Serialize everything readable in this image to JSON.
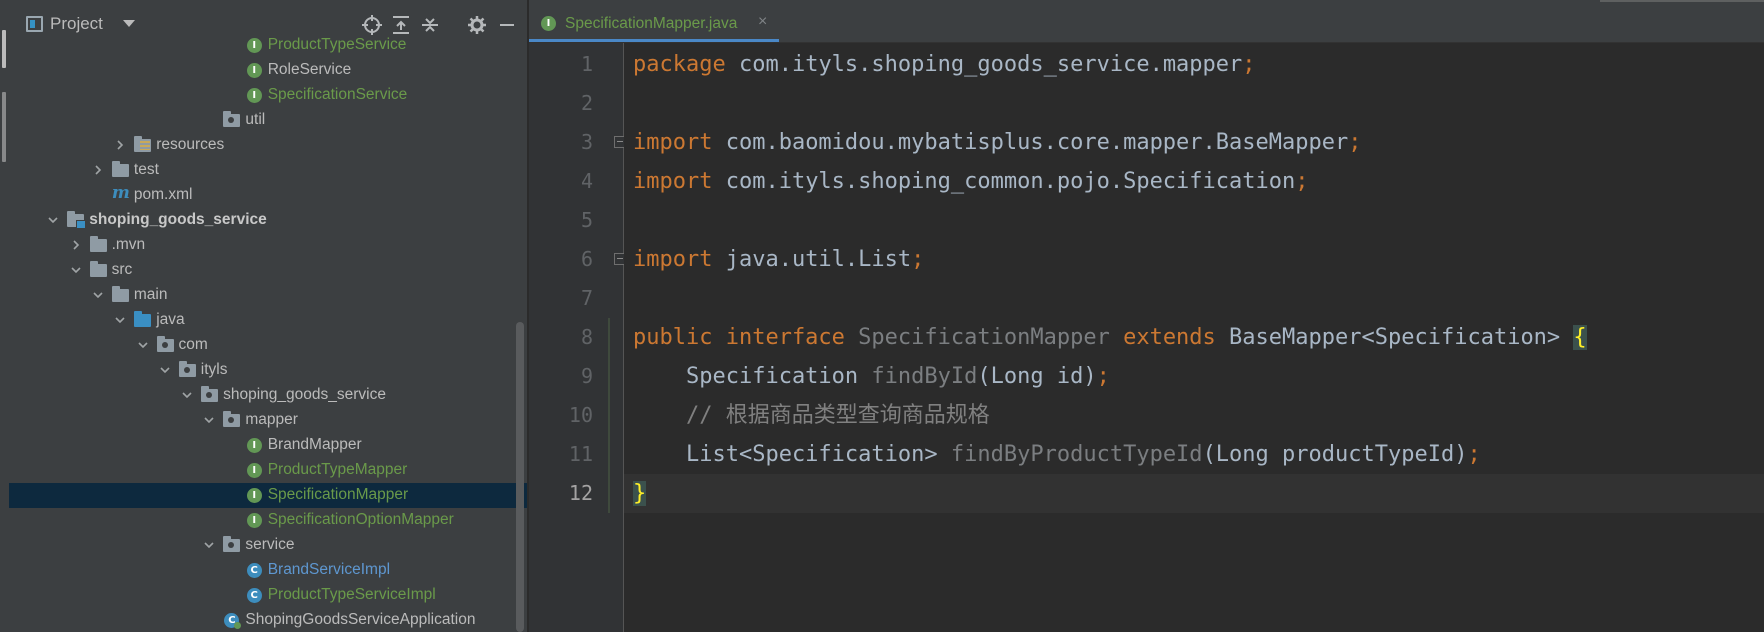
{
  "project_panel": {
    "title": "Project",
    "tree": [
      {
        "label": "ProductTypeService",
        "icon": "interface",
        "color": "green"
      },
      {
        "label": "RoleService",
        "icon": "interface",
        "color": "normal"
      },
      {
        "label": "SpecificationService",
        "icon": "interface",
        "color": "green"
      },
      {
        "label": "util",
        "icon": "package-folder",
        "color": "normal"
      },
      {
        "label": "resources",
        "icon": "resources-folder",
        "color": "normal",
        "expanded": false
      },
      {
        "label": "test",
        "icon": "folder",
        "color": "normal",
        "expanded": false
      },
      {
        "label": "pom.xml",
        "icon": "maven",
        "color": "normal"
      },
      {
        "label": "shoping_goods_service",
        "icon": "module-folder",
        "color": "bold",
        "expanded": true
      },
      {
        "label": ".mvn",
        "icon": "folder",
        "color": "normal",
        "expanded": false
      },
      {
        "label": "src",
        "icon": "folder",
        "color": "normal",
        "expanded": true
      },
      {
        "label": "main",
        "icon": "folder",
        "color": "normal",
        "expanded": true
      },
      {
        "label": "java",
        "icon": "source-folder",
        "color": "normal",
        "expanded": true
      },
      {
        "label": "com",
        "icon": "package-folder",
        "color": "normal",
        "expanded": true
      },
      {
        "label": "ityls",
        "icon": "package-folder",
        "color": "normal",
        "expanded": true
      },
      {
        "label": "shoping_goods_service",
        "icon": "package-folder",
        "color": "normal",
        "expanded": true
      },
      {
        "label": "mapper",
        "icon": "package-folder",
        "color": "normal",
        "expanded": true
      },
      {
        "label": "BrandMapper",
        "icon": "interface",
        "color": "normal"
      },
      {
        "label": "ProductTypeMapper",
        "icon": "interface",
        "color": "green"
      },
      {
        "label": "SpecificationMapper",
        "icon": "interface",
        "color": "green",
        "selected": true
      },
      {
        "label": "SpecificationOptionMapper",
        "icon": "interface",
        "color": "green"
      },
      {
        "label": "service",
        "icon": "package-folder",
        "color": "normal",
        "expanded": true
      },
      {
        "label": "BrandServiceImpl",
        "icon": "class",
        "color": "blue"
      },
      {
        "label": "ProductTypeServiceImpl",
        "icon": "class",
        "color": "green"
      },
      {
        "label": "ShopingGoodsServiceApplication",
        "icon": "spring-app",
        "color": "normal"
      }
    ]
  },
  "editor": {
    "tab": {
      "title": "SpecificationMapper.java",
      "close": "×",
      "icon": "interface"
    },
    "current_line": 12,
    "lines": [
      {
        "n": "1",
        "tokens": [
          {
            "t": "package ",
            "c": "kw"
          },
          {
            "t": "com.ityls.shoping_goods_service.mapper",
            "c": ""
          },
          {
            "t": ";",
            "c": "kw"
          }
        ]
      },
      {
        "n": "2",
        "tokens": []
      },
      {
        "n": "3",
        "tokens": [
          {
            "t": "import ",
            "c": "kw"
          },
          {
            "t": "com.baomidou.mybatisplus.core.mapper.BaseMapper",
            "c": ""
          },
          {
            "t": ";",
            "c": "kw"
          }
        ]
      },
      {
        "n": "4",
        "tokens": [
          {
            "t": "import ",
            "c": "kw"
          },
          {
            "t": "com.ityls.shoping_common.pojo.Specification",
            "c": ""
          },
          {
            "t": ";",
            "c": "kw"
          }
        ]
      },
      {
        "n": "5",
        "tokens": []
      },
      {
        "n": "6",
        "tokens": [
          {
            "t": "import ",
            "c": "kw"
          },
          {
            "t": "java.util.List",
            "c": ""
          },
          {
            "t": ";",
            "c": "kw"
          }
        ]
      },
      {
        "n": "7",
        "tokens": []
      },
      {
        "n": "8",
        "tokens": [
          {
            "t": "public interface ",
            "c": "kw"
          },
          {
            "t": "SpecificationMapper ",
            "c": "fn"
          },
          {
            "t": "extends ",
            "c": "kw"
          },
          {
            "t": "BaseMapper<Specification> ",
            "c": ""
          },
          {
            "t": "{",
            "c": "brace-hl"
          }
        ]
      },
      {
        "n": "9",
        "tokens": [
          {
            "t": "    Specification ",
            "c": ""
          },
          {
            "t": "findById",
            "c": "fn"
          },
          {
            "t": "(Long id)",
            "c": ""
          },
          {
            "t": ";",
            "c": "kw"
          }
        ]
      },
      {
        "n": "10",
        "tokens": [
          {
            "t": "    // 根据商品类型查询商品规格",
            "c": "cm"
          }
        ]
      },
      {
        "n": "11",
        "tokens": [
          {
            "t": "    List<Specification> ",
            "c": ""
          },
          {
            "t": "findByProductTypeId",
            "c": "fn"
          },
          {
            "t": "(Long productTypeId)",
            "c": ""
          },
          {
            "t": ";",
            "c": "kw"
          }
        ]
      },
      {
        "n": "12",
        "tokens": [
          {
            "t": "}",
            "c": "brace-hl"
          }
        ]
      }
    ]
  },
  "colors": {
    "keyword": "#cc7832",
    "method": "#7b7e81",
    "comment": "#808080",
    "vcs_new": "#6a9a4a",
    "selection": "#0d293e",
    "tab_underline": "#4a88c7"
  }
}
